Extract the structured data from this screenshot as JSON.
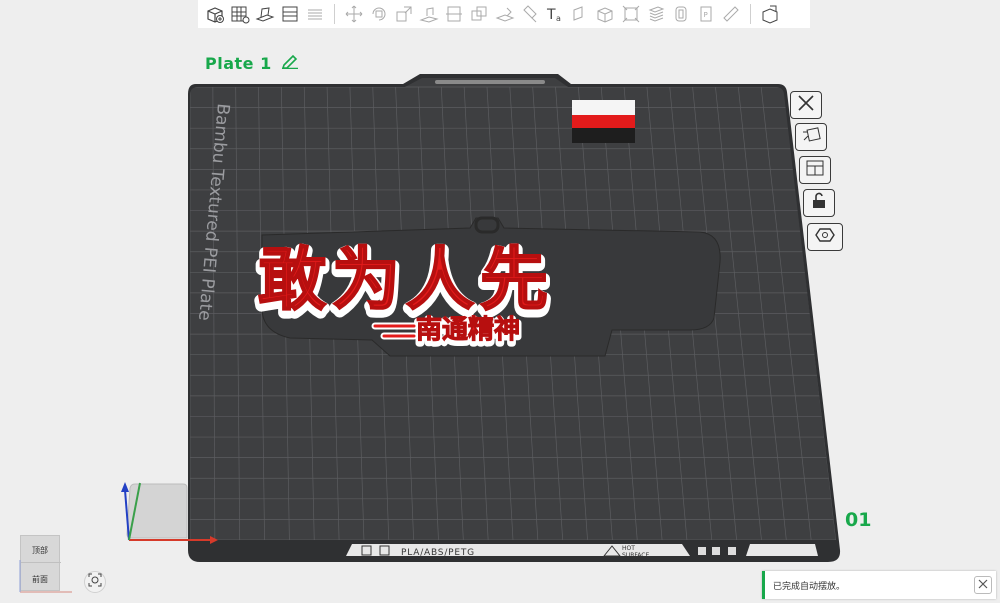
{
  "toolbar": {
    "icons": [
      "add-cube-icon",
      "grid-arrange-icon",
      "auto-orient-icon",
      "plate-layout-icon",
      "layers-icon",
      "move-icon",
      "rotate-icon",
      "scale-icon",
      "lay-flat-icon",
      "cut-icon",
      "boolean-icon",
      "support-paint-icon",
      "color-paint-icon",
      "text-tool-icon",
      "measure-icon",
      "assembly-icon",
      "bounding-box-icon",
      "stack-icon",
      "variable-layer-icon",
      "seam-icon",
      "ruler-icon",
      "split-icon"
    ]
  },
  "plate": {
    "title": "Plate 1",
    "number": "01",
    "bed_name": "Bambu Textured PEI Plate",
    "filament_text": "PLA/ABS/PETG",
    "hot_surface_line1": "HOT",
    "hot_surface_line2": "SURFACE"
  },
  "model": {
    "main_text": "敢为人先",
    "sub_text": "南通精神"
  },
  "orientation": {
    "top_label": "顶部",
    "front_label": "前面"
  },
  "notification": {
    "message": "已完成自动摆放。"
  },
  "colors": {
    "accent": "#18a84b",
    "bed": "#3e3f41",
    "model_red": "#e31b1b"
  }
}
